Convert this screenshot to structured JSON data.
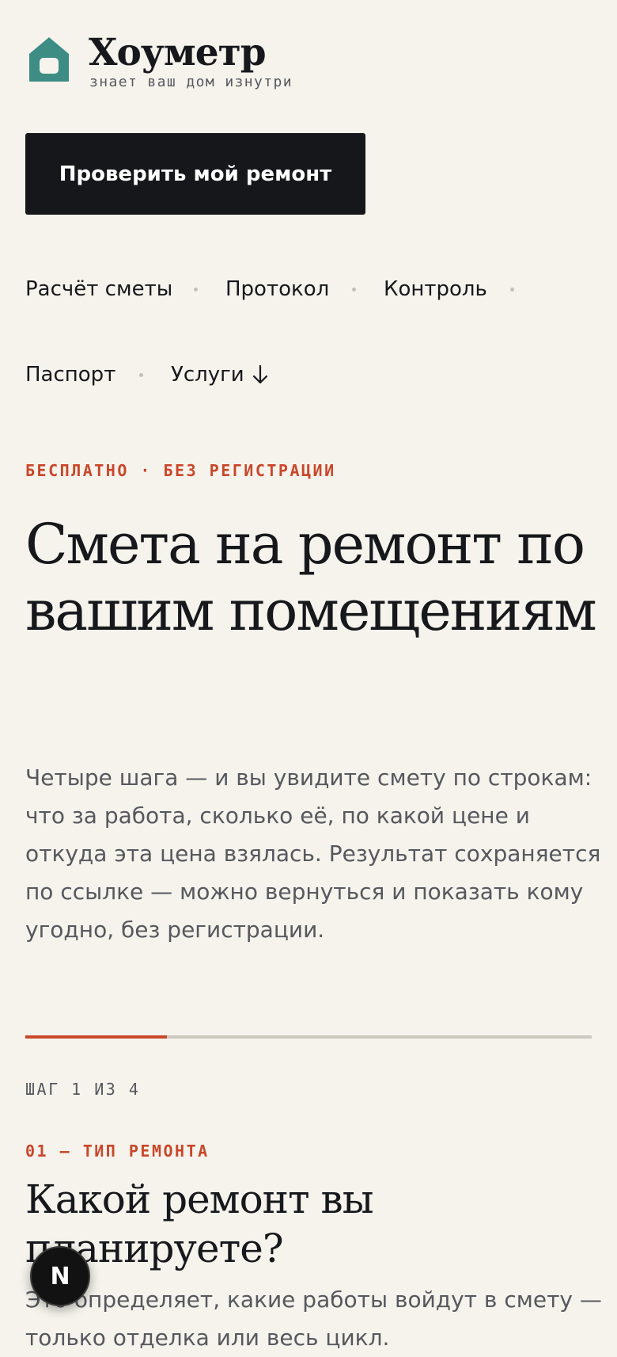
{
  "brand": {
    "name": "Хоуметр",
    "tagline": "знает ваш дом изнутри"
  },
  "cta": {
    "label": "Проверить мой ремонт"
  },
  "nav": {
    "items": [
      {
        "label": "Расчёт сметы"
      },
      {
        "label": "Протокол"
      },
      {
        "label": "Контроль"
      },
      {
        "label": "Паспорт"
      },
      {
        "label": "Услуги",
        "icon": "arrow-down-icon"
      }
    ]
  },
  "hero": {
    "eyebrow": "БЕСПЛАТНО · БЕЗ РЕГИСТРАЦИИ",
    "title": "Смета на ремонт по вашим помещениям",
    "lead": "Четыре шага — и вы увидите смету по строкам: что за работа, сколько её, по какой цене и откуда эта цена взялась. Результат сохраняется по ссылке — можно вернуться и показать кому угодно, без регистрации."
  },
  "wizard": {
    "progress_fraction": 0.25,
    "step_counter": "ШАГ 1 ИЗ 4",
    "step_eyebrow": "01 — ТИП РЕМОНТА",
    "step_title": "Какой ремонт вы планируете?",
    "step_desc": "Это определяет, какие работы войдут в смету — только отделка или весь цикл."
  },
  "dev_badge": {
    "label": "N"
  },
  "colors": {
    "background": "#f5f3ec",
    "ink": "#17181c",
    "muted": "#56585e",
    "accent": "#c9472a",
    "logo": "#3d8d85",
    "button": "#16171b"
  }
}
